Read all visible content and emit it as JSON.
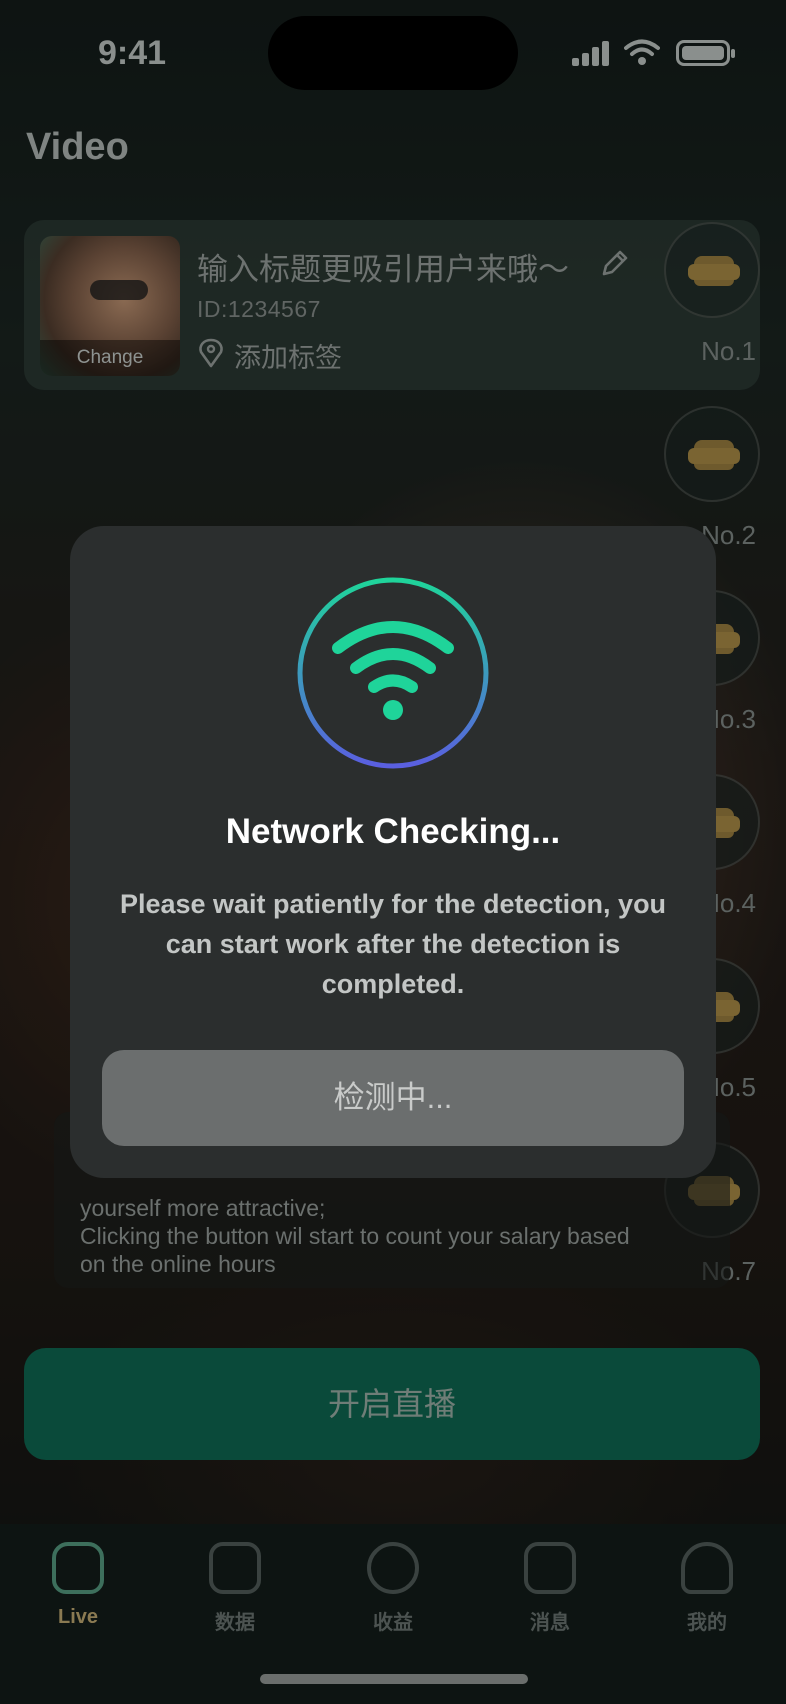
{
  "status_bar": {
    "time": "9:41"
  },
  "page": {
    "title": "Video"
  },
  "profile_card": {
    "title": "输入标题更吸引用户来哦～",
    "id": "ID:1234567",
    "tag_label": "添加标签",
    "avatar_action": "Change"
  },
  "ranking": {
    "labels": [
      "No.1",
      "No.2",
      "No.3",
      "No.4",
      "No.5",
      "No.7"
    ]
  },
  "info": {
    "line1": "yourself more attractive;",
    "line2": "Clicking the button wil start to count your salary based",
    "line3": "on the online hours"
  },
  "start_button": {
    "label": "开启直播"
  },
  "tabbar": {
    "items": [
      {
        "label": "Live",
        "icon": "home-icon",
        "active": true
      },
      {
        "label": "数据",
        "icon": "chart-icon",
        "active": false
      },
      {
        "label": "收益",
        "icon": "dollar-icon",
        "active": false
      },
      {
        "label": "消息",
        "icon": "message-icon",
        "active": false
      },
      {
        "label": "我的",
        "icon": "user-icon",
        "active": false
      }
    ]
  },
  "modal": {
    "icon": "wifi-icon",
    "title": "Network Checking...",
    "body": "Please wait patiently for the detection, you can start work after the detection is completed.",
    "button_label": "检测中...",
    "colors": {
      "accent_green": "#1fd49a",
      "accent_blue": "#5a5fe0",
      "background": "#2b2e2e"
    }
  }
}
